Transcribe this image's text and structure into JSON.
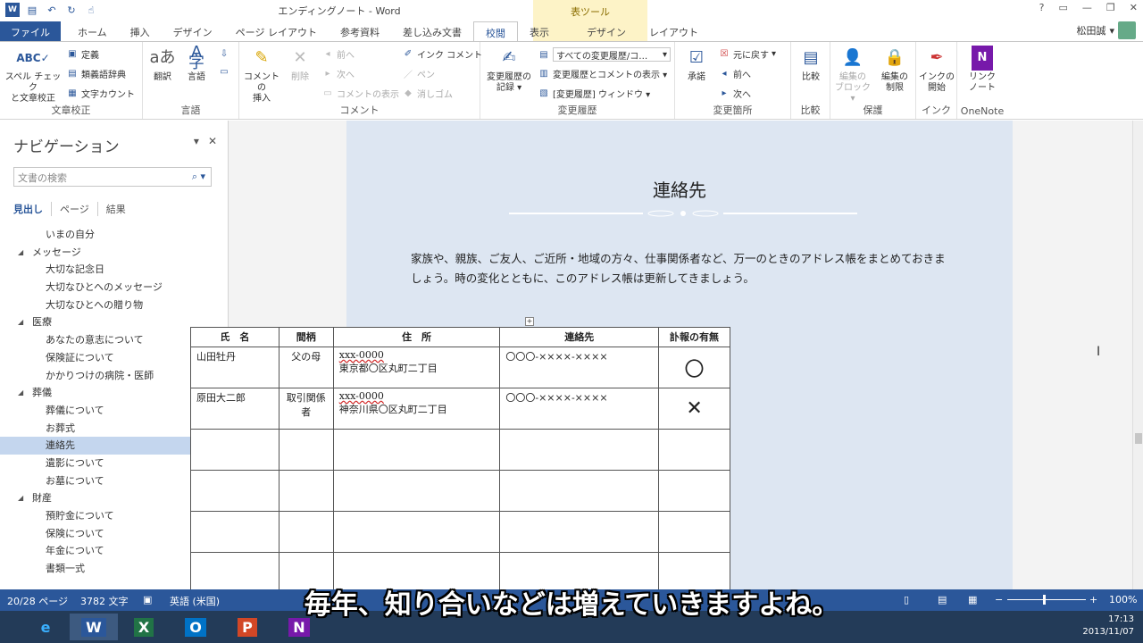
{
  "window": {
    "title": "エンディングノート - Word",
    "context_group": "表ツール",
    "user": "松田誠",
    "controls": [
      "?",
      "▭",
      "—",
      "❐",
      "✕"
    ]
  },
  "tabs": [
    "ファイル",
    "ホーム",
    "挿入",
    "デザイン",
    "ページ レイアウト",
    "参考資料",
    "差し込み文書",
    "校閲",
    "表示",
    "デザイン",
    "レイアウト"
  ],
  "ribbon": {
    "proof": {
      "label": "文章校正",
      "spell": "スペル チェック\nと文章校正",
      "define": "定義",
      "thesaurus": "類義語辞典",
      "wordcount": "文字カウント"
    },
    "language": {
      "label": "言語",
      "translate": "翻訳",
      "language": "言語"
    },
    "comments": {
      "label": "コメント",
      "new": "コメントの\n挿入",
      "delete": "削除",
      "prev": "前へ",
      "next": "次へ",
      "show": "コメントの表示",
      "ink": "インク コメント",
      "pen": "ペン",
      "eraser": "消しゴム"
    },
    "tracking": {
      "label": "変更履歴",
      "track": "変更履歴の\n記録 ▾",
      "markup": "すべての変更履歴/コ…",
      "show_markup": "変更履歴とコメントの表示 ▾",
      "pane": "[変更履歴] ウィンドウ ▾"
    },
    "changes": {
      "label": "変更箇所",
      "accept": "承諾",
      "reject": "元に戻す",
      "prev": "前へ",
      "next": "次へ"
    },
    "compare": {
      "label": "比較",
      "compare": "比較"
    },
    "protect": {
      "label": "保護",
      "block": "編集の\nブロック ▾",
      "restrict": "編集の\n制限"
    },
    "ink": {
      "label": "インク",
      "start": "インクの\n開始"
    },
    "onenote": {
      "label": "OneNote",
      "link": "リンク\nノート"
    }
  },
  "nav": {
    "title": "ナビゲーション",
    "search_placeholder": "文書の検索",
    "tabs": [
      "見出し",
      "ページ",
      "結果"
    ],
    "items": [
      {
        "text": "いまの自分",
        "level": 2
      },
      {
        "text": "メッセージ",
        "level": 1
      },
      {
        "text": "大切な記念日",
        "level": 2
      },
      {
        "text": "大切なひとへのメッセージ",
        "level": 2
      },
      {
        "text": "大切なひとへの贈り物",
        "level": 2
      },
      {
        "text": "医療",
        "level": 1
      },
      {
        "text": "あなたの意志について",
        "level": 2
      },
      {
        "text": "保険証について",
        "level": 2
      },
      {
        "text": "かかりつけの病院・医師",
        "level": 2
      },
      {
        "text": "葬儀",
        "level": 1
      },
      {
        "text": "葬儀について",
        "level": 2
      },
      {
        "text": "お葬式",
        "level": 2
      },
      {
        "text": "連絡先",
        "level": 2,
        "selected": true
      },
      {
        "text": "遺影について",
        "level": 2
      },
      {
        "text": "お墓について",
        "level": 2
      },
      {
        "text": "財産",
        "level": 1
      },
      {
        "text": "預貯金について",
        "level": 2
      },
      {
        "text": "保険について",
        "level": 2
      },
      {
        "text": "年金について",
        "level": 2
      },
      {
        "text": "書類一式",
        "level": 2
      }
    ]
  },
  "doc": {
    "title": "連絡先",
    "paragraph": "家族や、親族、ご友人、ご近所・地域の方々、仕事関係者など、万一のときのアドレス帳をまとめておきましょう。時の変化とともに、このアドレス帳は更新してきましょう。",
    "table": {
      "headers": [
        "氏　名",
        "間柄",
        "住　所",
        "連絡先",
        "訃報の有無"
      ],
      "rows": [
        [
          "山田牡丹",
          "父の母",
          "xxx-0000",
          "東京都〇区丸町二丁目",
          "〇〇〇-××××-××××",
          "〇"
        ],
        [
          "原田大二郎",
          "取引関係者",
          "xxx-0000",
          "神奈川県〇区丸町二丁目",
          "〇〇〇-××××-××××",
          "✕"
        ]
      ],
      "empty_rows": 4
    }
  },
  "status": {
    "page": "20/28 ページ",
    "words": "3782 文字",
    "lang": "英語 (米国)",
    "zoom": "100%"
  },
  "tray": {
    "time": "17:13",
    "date": "2013/11/07"
  },
  "subtitle": "毎年、知り合いなどは増えていきますよね。"
}
